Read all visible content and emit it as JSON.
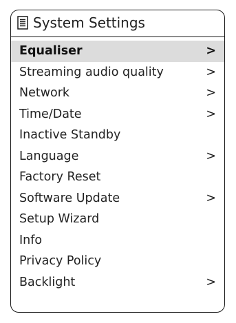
{
  "header": {
    "title": "System Settings",
    "icon": "list-document-icon"
  },
  "menu": {
    "selected_index": 0,
    "items": [
      {
        "label": "Equaliser",
        "arrow": ">"
      },
      {
        "label": "Streaming audio quality",
        "arrow": ">"
      },
      {
        "label": "Network",
        "arrow": ">"
      },
      {
        "label": "Time/Date",
        "arrow": ">"
      },
      {
        "label": "Inactive Standby",
        "arrow": ""
      },
      {
        "label": "Language",
        "arrow": ">"
      },
      {
        "label": "Factory Reset",
        "arrow": ""
      },
      {
        "label": "Software Update",
        "arrow": ">"
      },
      {
        "label": "Setup Wizard",
        "arrow": ""
      },
      {
        "label": "Info",
        "arrow": ""
      },
      {
        "label": "Privacy Policy",
        "arrow": ""
      },
      {
        "label": "Backlight",
        "arrow": ">"
      }
    ]
  }
}
